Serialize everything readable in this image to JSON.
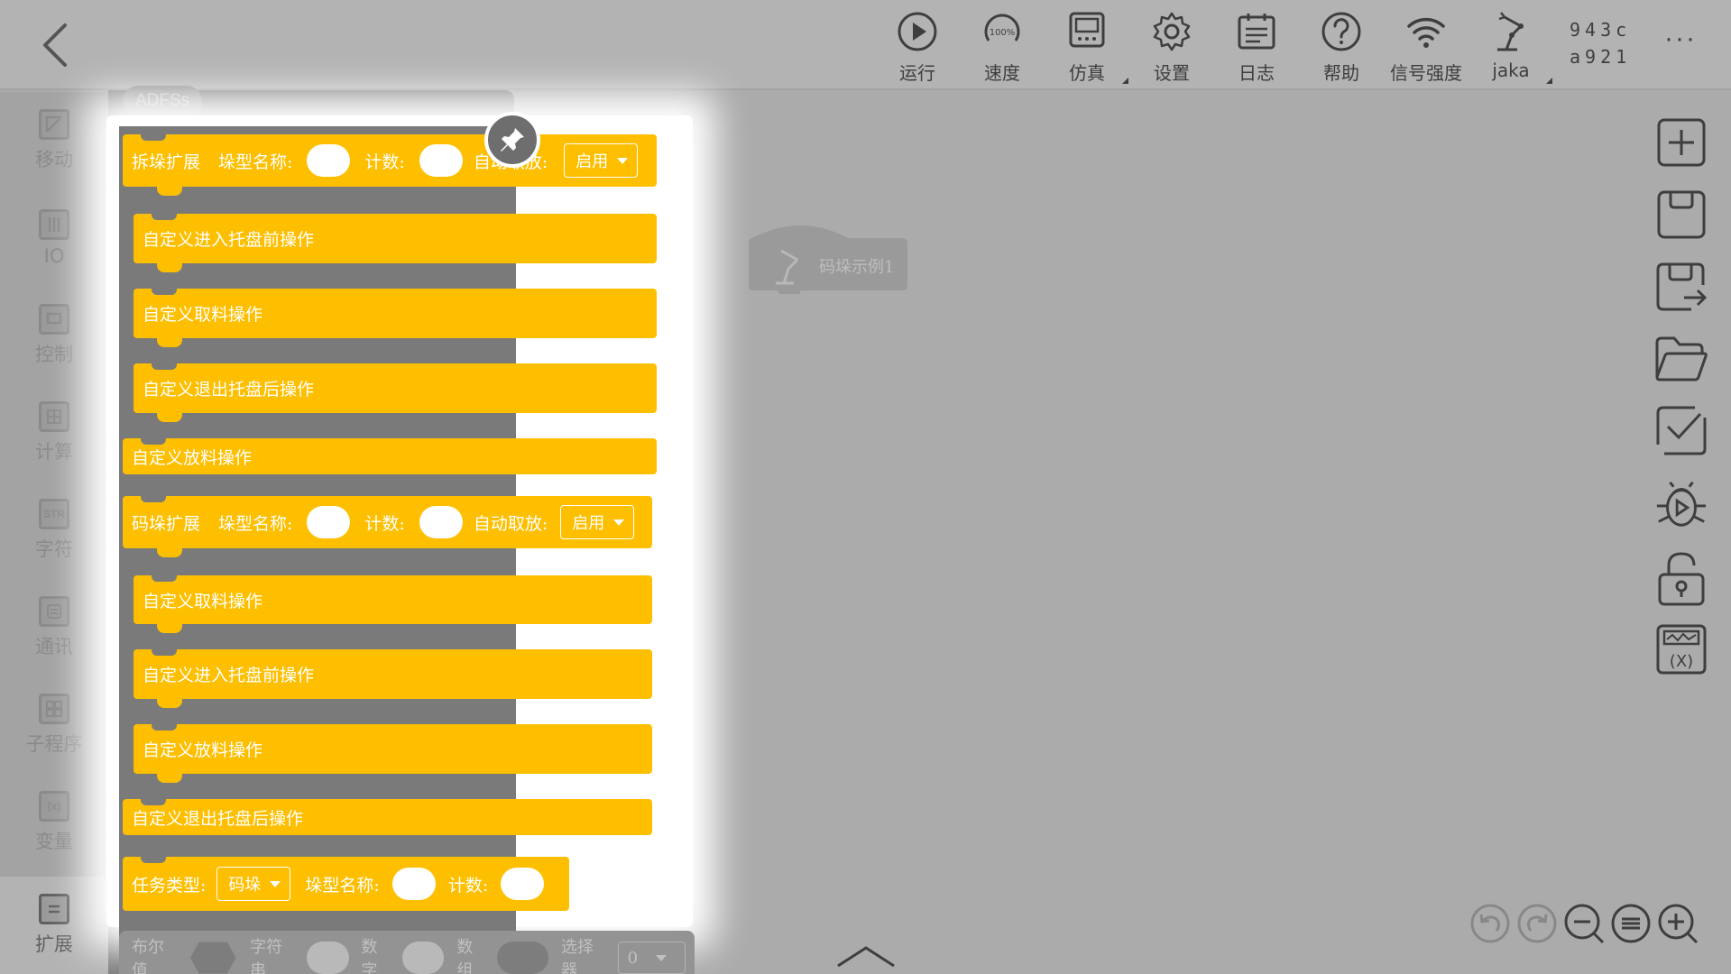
{
  "topbar": {
    "items": [
      {
        "label": "运行",
        "icon": "play-icon"
      },
      {
        "label": "速度",
        "icon": "speed-gauge-icon",
        "badge": "100%"
      },
      {
        "label": "仿真",
        "icon": "simulation-icon"
      },
      {
        "label": "设置",
        "icon": "gear-icon"
      },
      {
        "label": "日志",
        "icon": "log-icon"
      },
      {
        "label": "帮助",
        "icon": "help-icon"
      },
      {
        "label": "信号强度",
        "icon": "wifi-icon"
      },
      {
        "label": "jaka",
        "icon": "robot-arm-icon"
      }
    ],
    "device_id_line1": "943c",
    "device_id_line2": "a921",
    "more": "···"
  },
  "categories": [
    {
      "label": "移动",
      "icon": "move-icon"
    },
    {
      "label": "IO",
      "icon": "io-icon",
      "glyph": "IO"
    },
    {
      "label": "控制",
      "icon": "control-icon"
    },
    {
      "label": "计算",
      "icon": "calc-icon"
    },
    {
      "label": "字符",
      "icon": "string-icon",
      "glyph": "STR"
    },
    {
      "label": "通讯",
      "icon": "comm-icon"
    },
    {
      "label": "子程序",
      "icon": "subprogram-icon"
    },
    {
      "label": "变量",
      "icon": "variable-icon",
      "glyph": "(x)"
    },
    {
      "label": "扩展",
      "icon": "extension-icon",
      "active": true
    }
  ],
  "flyout": {
    "tag": "ADFSs",
    "depal": {
      "title": "拆垛扩展",
      "type_label": "垛型名称:",
      "count_label": "计数:",
      "auto_label": "自动取放:",
      "auto_value": "启用",
      "slots": [
        "自定义进入托盘前操作",
        "自定义取料操作",
        "自定义退出托盘后操作"
      ],
      "footer": "自定义放料操作"
    },
    "pal": {
      "title": "码垛扩展",
      "type_label": "垛型名称:",
      "count_label": "计数:",
      "auto_label": "自动取放:",
      "auto_value": "启用",
      "slots": [
        "自定义取料操作",
        "自定义进入托盘前操作",
        "自定义放料操作"
      ],
      "footer": "自定义退出托盘后操作"
    },
    "task": {
      "type_label": "任务类型:",
      "type_value": "码垛",
      "name_label": "垛型名称:",
      "count_label": "计数:"
    },
    "bottom_row": {
      "bool": "布尔值",
      "string": "字符串",
      "number": "数字",
      "array": "数组",
      "selector": "选择器",
      "selector_value": "0"
    }
  },
  "canvas": {
    "block_label": "码垛示例1"
  },
  "right_toolbar": [
    "add-icon",
    "save-icon",
    "save-as-icon",
    "open-folder-icon",
    "checklist-icon",
    "debug-icon",
    "unlock-icon",
    "variable-monitor-icon"
  ],
  "zoom_controls": [
    "undo-icon",
    "redo-icon",
    "zoom-out-icon",
    "zoom-reset-icon",
    "zoom-in-icon"
  ]
}
